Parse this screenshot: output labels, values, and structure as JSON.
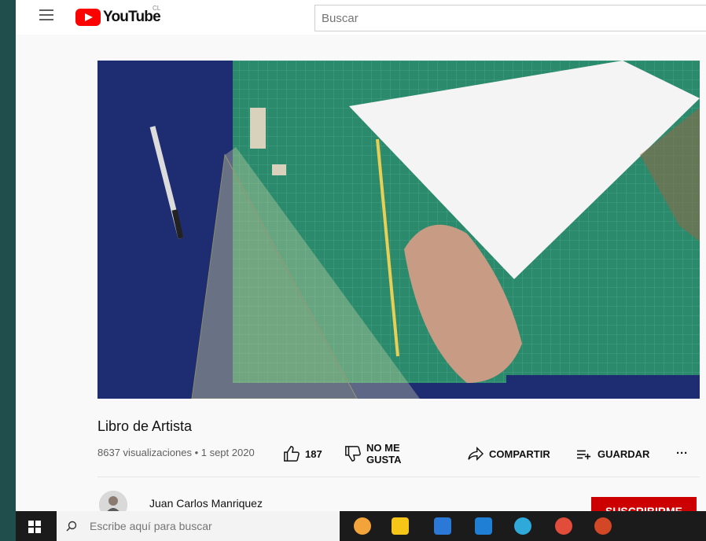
{
  "header": {
    "logo_text": "YouTube",
    "country_code": "CL",
    "search_placeholder": "Buscar"
  },
  "video": {
    "title": "Libro de Artista",
    "views_date": "8637 visualizaciones • 1 sept 2020",
    "like_count": "187",
    "dislike_label_1": "NO ME",
    "dislike_label_2": "GUSTA",
    "share_label": "COMPARTIR",
    "save_label": "GUARDAR",
    "more_label": "···"
  },
  "channel": {
    "name": "Juan Carlos Manriquez",
    "subscribe_label": "SUSCRIBIRME"
  },
  "taskbar": {
    "search_placeholder": "Escribe aquí para buscar"
  },
  "colors": {
    "brand_red": "#ff0000",
    "subscribe_red": "#cc0000",
    "taskbar": "#1b1b1b",
    "desktop": "#1f4e4c"
  }
}
